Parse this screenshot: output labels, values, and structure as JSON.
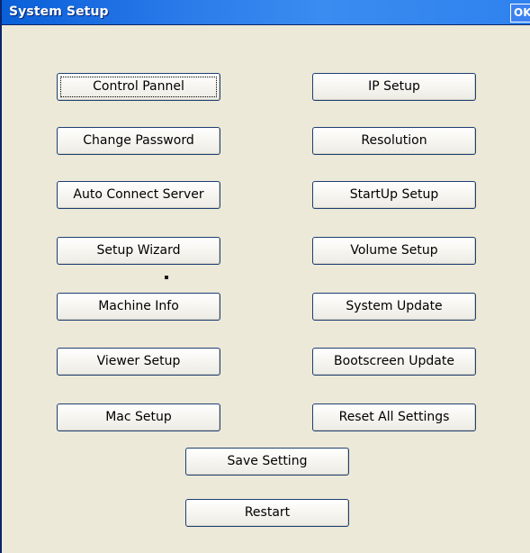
{
  "window": {
    "title": "System Setup",
    "ok_label": "OK"
  },
  "buttons": {
    "control_panel": "Control Pannel",
    "ip_setup": "IP Setup",
    "change_password": "Change Password",
    "resolution": "Resolution",
    "auto_connect_server": "Auto Connect Server",
    "startup_setup": "StartUp Setup",
    "setup_wizard": "Setup Wizard",
    "volume_setup": "Volume Setup",
    "machine_info": "Machine Info",
    "system_update": "System Update",
    "viewer_setup": "Viewer Setup",
    "bootscreen_update": "Bootscreen Update",
    "mac_setup": "Mac Setup",
    "reset_all_settings": "Reset All Settings",
    "save_setting": "Save Setting",
    "restart": "Restart"
  },
  "colors": {
    "titlebar": "#2b7bea",
    "window_background": "#ece9d8",
    "button_border": "#1e3f74"
  }
}
